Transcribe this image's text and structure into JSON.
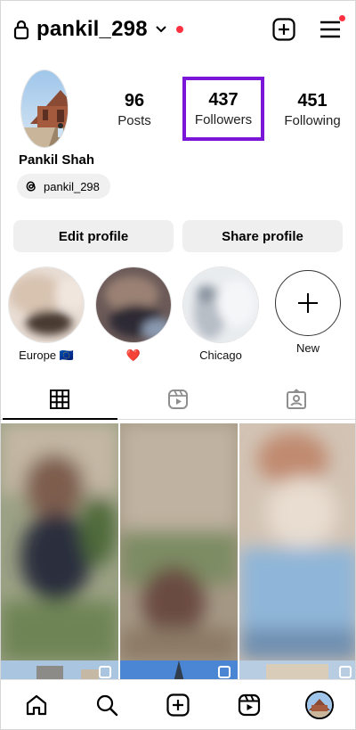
{
  "header": {
    "username": "pankil_298",
    "lock_icon": "lock-icon",
    "dropdown_icon": "chevron-down-icon",
    "create_icon": "plus-square-icon",
    "menu_icon": "hamburger-menu-icon"
  },
  "profile": {
    "display_name": "Pankil Shah",
    "threads_handle": "pankil_298",
    "stats": {
      "posts": {
        "value": "96",
        "label": "Posts"
      },
      "followers": {
        "value": "437",
        "label": "Followers"
      },
      "following": {
        "value": "451",
        "label": "Following"
      }
    },
    "highlight_color": "#7a16d8"
  },
  "actions": {
    "edit_label": "Edit profile",
    "share_label": "Share profile"
  },
  "highlights": [
    {
      "label": "Europe 🇪🇺"
    },
    {
      "label": "❤️"
    },
    {
      "label": "Chicago"
    },
    {
      "label": "New"
    }
  ],
  "tabs": [
    {
      "icon": "grid-icon",
      "active": true
    },
    {
      "icon": "reels-icon",
      "active": false
    },
    {
      "icon": "tagged-icon",
      "active": false
    }
  ],
  "bottom_nav": [
    {
      "icon": "home-icon"
    },
    {
      "icon": "search-icon"
    },
    {
      "icon": "create-icon"
    },
    {
      "icon": "reels-icon"
    },
    {
      "icon": "profile-avatar"
    }
  ],
  "colors": {
    "notification": "#ff3040",
    "button_bg": "#efefef"
  }
}
